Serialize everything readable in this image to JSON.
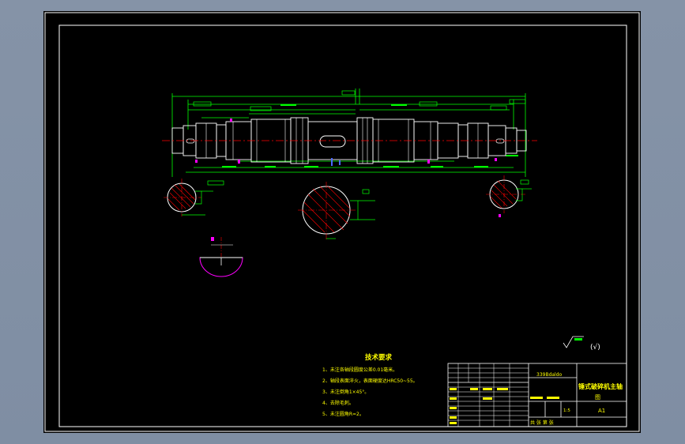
{
  "technical_requirements": {
    "title": "技术要求",
    "items": [
      "1、未注各轴段圆度公差0.01毫米。",
      "2、轴段表面淬火，表面硬度达HRC50~55。",
      "3、未注倒角1×45°。",
      "4、去除毛刺。",
      "5、未注圆角R=2。"
    ]
  },
  "roughness_note": "(√)",
  "title_block": {
    "drawing_title": "锤式破碎机主轴",
    "drawing_title_line2": "图",
    "code": "339Bdaldo",
    "sheet_size": "A1",
    "scale_value": "1:5",
    "footer_text": "共 张 第 张"
  },
  "colors": {
    "background": "#000000",
    "frame": "#ffffff",
    "geometry": "#ffffff",
    "dimensions": "#00ff00",
    "text": "#ffff00",
    "centerline": "#ff0000",
    "hatch": "#ff0000",
    "magenta": "#ff00ff",
    "blue": "#4a6bff"
  }
}
